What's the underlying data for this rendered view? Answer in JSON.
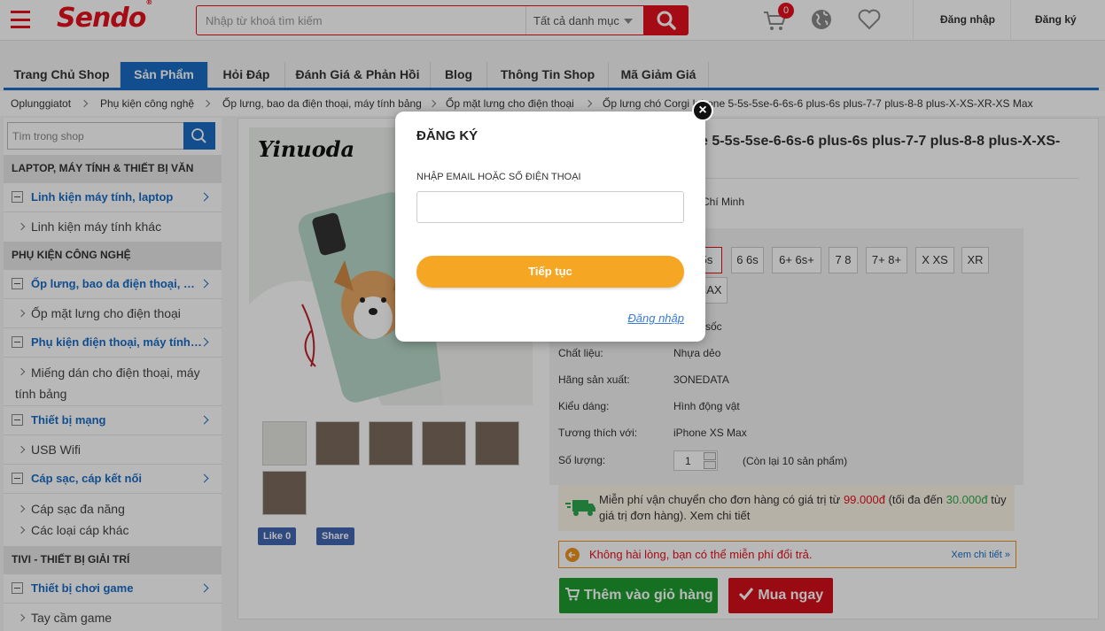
{
  "header": {
    "logo": "Sendo",
    "search_placeholder": "Nhập từ khoá tìm kiếm",
    "category": "Tất cả danh mục",
    "cart_count": "0",
    "login": "Đăng nhập",
    "register": "Đăng ký"
  },
  "tabs": [
    "Trang Chủ Shop",
    "Sản Phẩm",
    "Hỏi Đáp",
    "Đánh Giá & Phản Hồi",
    "Blog",
    "Thông Tin Shop",
    "Mã Giảm Giá"
  ],
  "breadcrumb": [
    "Oplunggiatot",
    "Phụ kiện công nghệ",
    "Ốp lưng, bao da điện thoại, máy tính bảng",
    "Ốp mặt lưng cho điện thoại",
    "Ốp lưng chó Corgi Iphone 5-5s-5se-6-6s-6 plus-6s plus-7-7 plus-8-8 plus-X-XS-XR-XS Max"
  ],
  "sidebar": {
    "search_placeholder": "Tìm trong shop",
    "groups": [
      {
        "heading": "LAPTOP, MÁY TÍNH & THIẾT BỊ VĂN",
        "cats": [
          {
            "label": "Linh kiện máy tính, laptop",
            "subs": [
              "Linh kiện máy tính khác"
            ]
          }
        ]
      },
      {
        "heading": "PHỤ KIỆN CÔNG NGHỆ",
        "cats": [
          {
            "label": "Ốp lưng, bao da điện thoại, máy...",
            "subs": [
              "Ốp mặt lưng cho điện thoại"
            ]
          },
          {
            "label": "Phụ kiện điện thoại, máy tính b...",
            "subs": [
              "Miếng dán cho điện thoại, máy tính bảng"
            ]
          },
          {
            "label": "Thiết bị mạng",
            "subs": [
              "USB Wifi"
            ]
          },
          {
            "label": "Cáp sạc, cáp kết nối",
            "subs": [
              "Cáp sạc đa năng",
              "Các loại cáp khác"
            ]
          }
        ]
      },
      {
        "heading": "TIVI - THIẾT BỊ GIẢI TRÍ",
        "cats": [
          {
            "label": "Thiết bị chơi game",
            "subs": [
              "Tay cầm game"
            ]
          }
        ]
      }
    ]
  },
  "product": {
    "image_brand": "Yinuoda",
    "title": "e 5-5s-5se-6-6s-6 plus-6s plus-7-7 plus-8-8 plus-X-XS-",
    "location": "Chí Minh",
    "variants_row1": [
      "5s",
      "6 6s",
      "6+ 6s+",
      "7 8",
      "7+ 8+",
      "X XS",
      "XR"
    ],
    "variant_row2": "MAX",
    "peek_text": "sốc",
    "specs": [
      {
        "label": "Chất liệu:",
        "value": "Nhựa dẻo"
      },
      {
        "label": "Hãng sản xuất:",
        "value": "3ONEDATA"
      },
      {
        "label": "Kiểu dáng:",
        "value": "Hình động vật"
      },
      {
        "label": "Tương thích với:",
        "value": "iPhone XS Max"
      }
    ],
    "quantity_label": "Số lượng:",
    "quantity": "1",
    "stock": "(Còn lại 10 sản phẩm)",
    "shipping_text_1": "Miễn phí vận chuyển cho đơn hàng có giá trị từ ",
    "shipping_amount_1": "99.000đ",
    "shipping_text_2": " (tối đa đến ",
    "shipping_amount_2": "30.000đ",
    "shipping_text_3": " tùy giá trị đơn hàng). Xem chi tiết",
    "return_text": "Không hài lòng, bạn có thể miễn phí đổi trả.",
    "return_link": "Xem chi tiết »",
    "add_to_cart": "Thêm vào giỏ hàng",
    "buy_now": "Mua ngay",
    "like": "Like 0",
    "share": "Share"
  },
  "modal": {
    "title": "ĐĂNG KÝ",
    "label": "NHẬP EMAIL HOẶC SỐ ĐIỆN THOẠI",
    "input_value": "",
    "continue": "Tiếp tục",
    "login_link": "Đăng nhập"
  },
  "colors": {
    "brand": "#e5101d",
    "primary": "#1a6cc4",
    "accent": "#f5a623",
    "cart_green": "#1e9c2f"
  }
}
